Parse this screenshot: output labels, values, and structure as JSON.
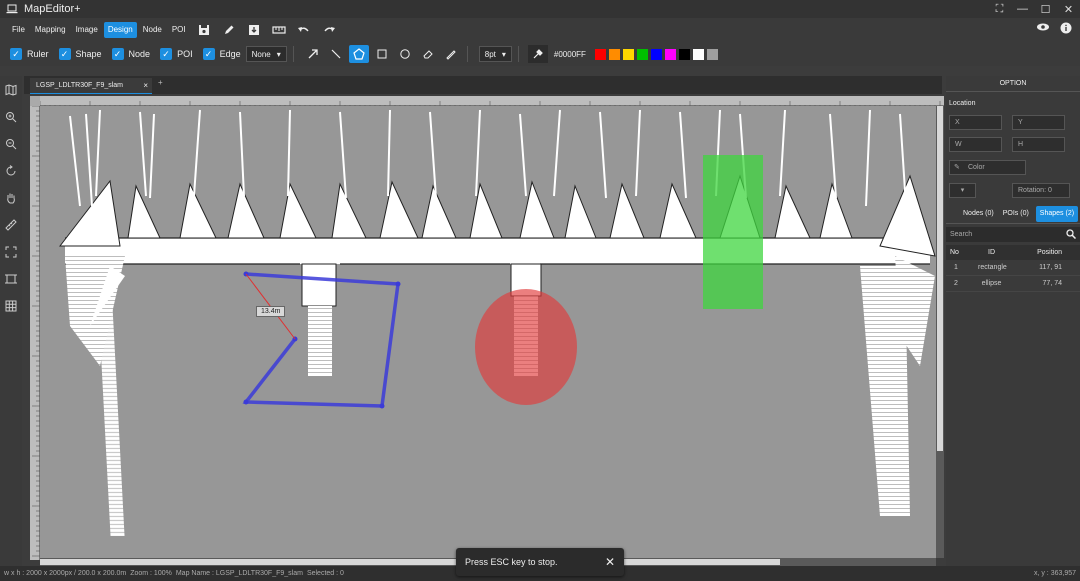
{
  "app": {
    "title": "MapEditor+"
  },
  "window_controls": [
    "fullscreen-icon",
    "minimize-icon",
    "maximize-icon",
    "close-icon"
  ],
  "menu": {
    "items": [
      "File",
      "Mapping",
      "Image",
      "Design",
      "Node",
      "POI"
    ],
    "active": "Design"
  },
  "toolbar_icons": [
    "save-icon",
    "pencil-icon",
    "import-icon",
    "ruler-icon",
    "undo-icon",
    "redo-icon"
  ],
  "options": {
    "toggles": [
      {
        "label": "Ruler",
        "checked": true
      },
      {
        "label": "Shape",
        "checked": true
      },
      {
        "label": "Node",
        "checked": true
      },
      {
        "label": "POI",
        "checked": true
      },
      {
        "label": "Edge",
        "checked": true
      }
    ],
    "edge_select": "None",
    "draw_tools": [
      "arrow-icon",
      "line-icon",
      "polygon-icon",
      "rectangle-icon",
      "ellipse-icon",
      "eraser-icon",
      "brush-icon"
    ],
    "active_tool": "polygon-icon",
    "stroke_width": "8pt",
    "color_value": "#0000FF",
    "palette": [
      "#ff0000",
      "#ff8c00",
      "#ffd700",
      "#00c000",
      "#0000ff",
      "#ff00ff",
      "#000000",
      "#ffffff",
      "#9e9e9e"
    ]
  },
  "document_tab": {
    "name": "LGSP_LDLTR30F_F9_slam",
    "close": "×",
    "add": "+"
  },
  "left_tools": [
    "map-icon",
    "zoom-in-icon",
    "zoom-out-icon",
    "rotate-icon",
    "hand-icon",
    "ruler-icon",
    "fit-icon",
    "crop-icon",
    "grid-icon"
  ],
  "canvas": {
    "measure_label": "13.4m",
    "toast_text": "Press ESC key to stop.",
    "toast_close": "✕"
  },
  "status": {
    "size": "w x h : 2000 x 2000px / 200.0 x 200.0m",
    "zoom": "Zoom : 100%",
    "map_name": "Map Name : LGSP_LDLTR30F_F9_slam",
    "selected": "Selected : 0",
    "cursor": "x, y : 363,957"
  },
  "panel": {
    "header": "OPTION",
    "location_label": "Location",
    "x_placeholder": "X",
    "y_placeholder": "Y",
    "w_placeholder": "W",
    "h_placeholder": "H",
    "color_label": "Color",
    "rotation": "Rotation: 0",
    "tabs": [
      "Nodes (0)",
      "POIs (0)",
      "Shapes (2)"
    ],
    "active_tab": "Shapes (2)",
    "search_placeholder": "Search",
    "columns": [
      "No",
      "ID",
      "Position"
    ],
    "rows": [
      {
        "no": "1",
        "id": "rectangle",
        "position": "117, 91"
      },
      {
        "no": "2",
        "id": "ellipse",
        "position": "77, 74"
      }
    ]
  }
}
